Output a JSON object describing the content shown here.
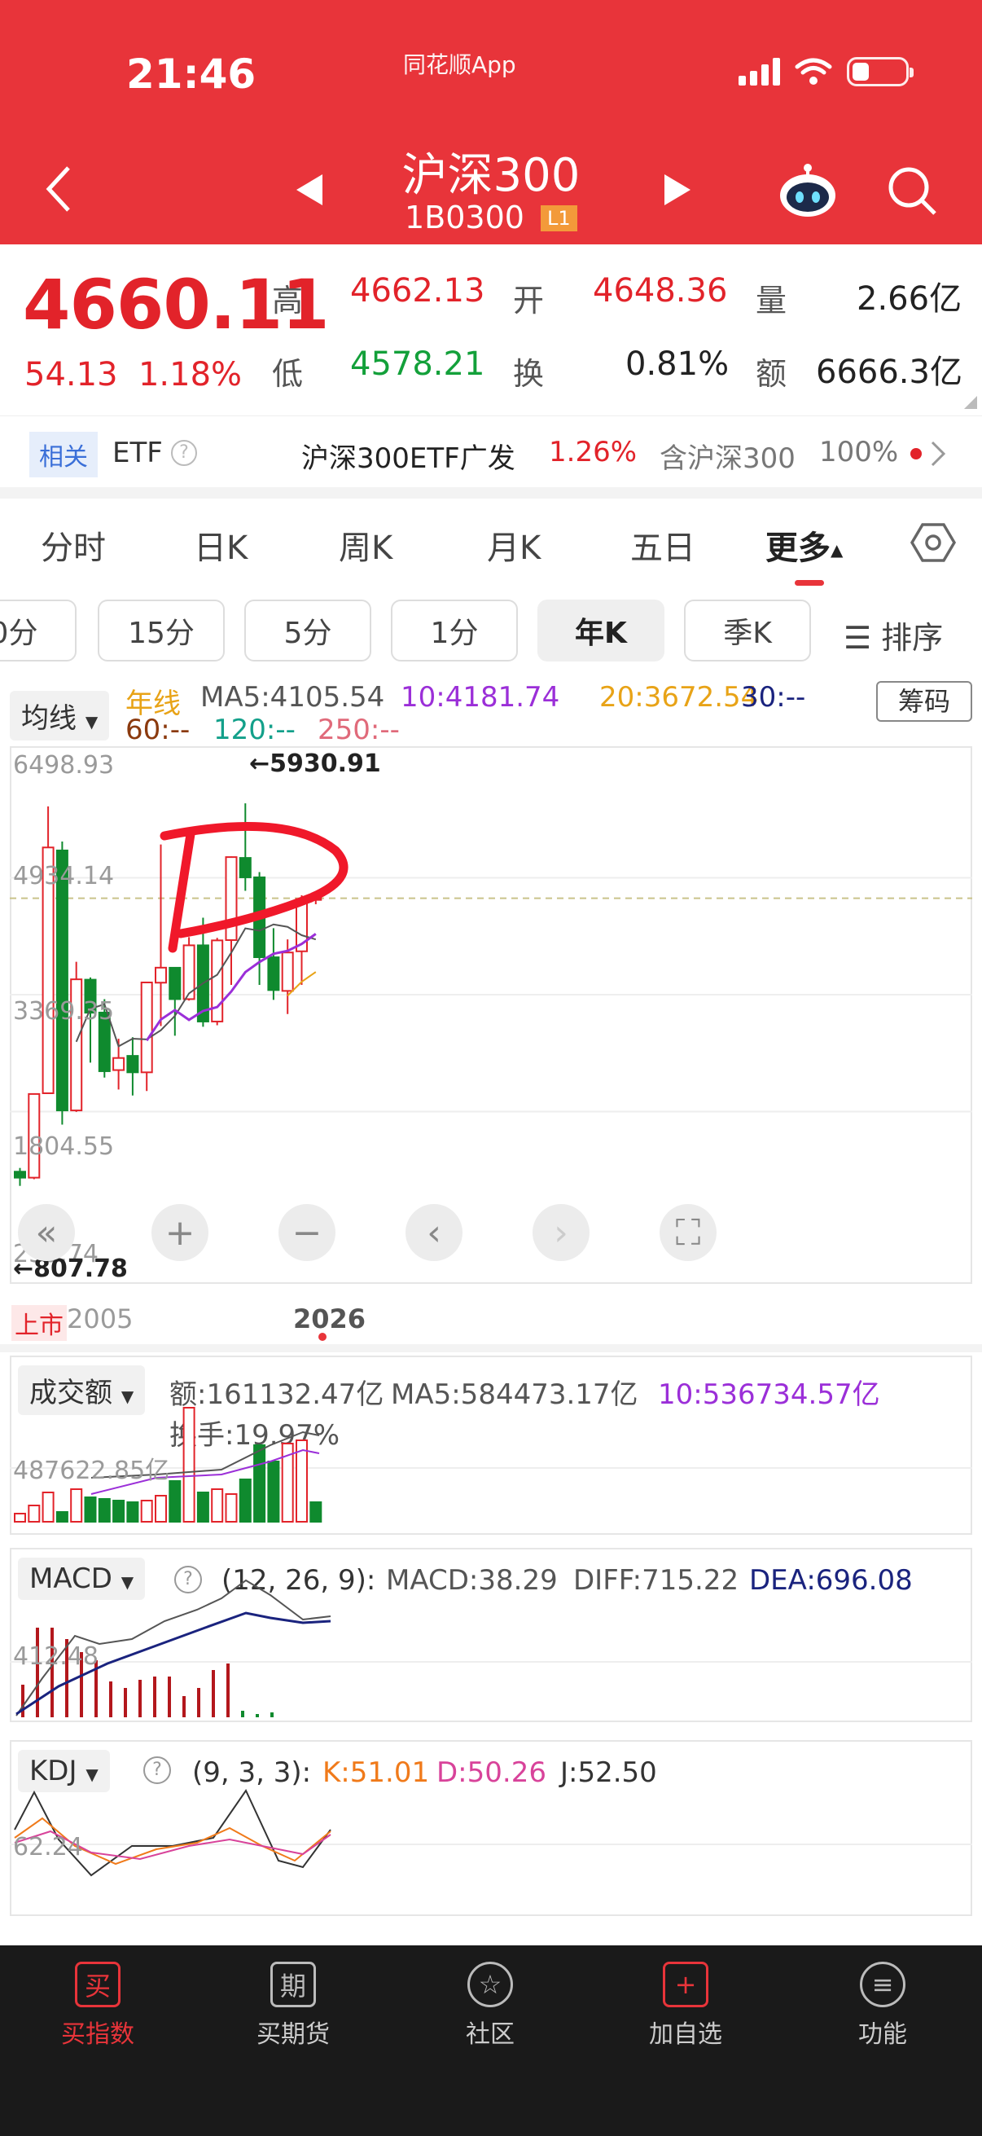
{
  "status_bar": {
    "time": "21:46",
    "app_name": "同花顺App"
  },
  "header": {
    "title": "沪深300",
    "code": "1B0300",
    "level_badge": "L1"
  },
  "quote": {
    "price": "4660.11",
    "change": "54.13",
    "change_pct": "1.18%",
    "high_label": "高",
    "high": "4662.13",
    "open_label": "开",
    "open": "4648.36",
    "volume_label": "量",
    "volume": "2.66亿",
    "low_label": "低",
    "low": "4578.21",
    "turnover_label": "换",
    "turnover": "0.81%",
    "amount_label": "额",
    "amount": "6666.3亿"
  },
  "etf": {
    "tag": "相关",
    "label": "ETF",
    "name": "沪深300ETF广发",
    "pct": "1.26%",
    "contains": "含沪深300",
    "contains_pct": "100%"
  },
  "tabs": [
    "分时",
    "日K",
    "周K",
    "月K",
    "五日",
    "更多"
  ],
  "periods": [
    "0分",
    "15分",
    "5分",
    "1分",
    "年K",
    "季K",
    "排序"
  ],
  "main_chart": {
    "indicator_dropdown": "均线",
    "ma_label": "年线",
    "ma5": "MA5:4105.54",
    "ma10": "10:4181.74",
    "ma20": "20:3672.54",
    "ma30": "30:--",
    "ma60": "60:--",
    "ma120": "120:--",
    "ma250": "250:--",
    "chip_button": "筹码",
    "y_labels": [
      "6498.93",
      "4934.14",
      "3369.35",
      "1804.55",
      "239.74"
    ],
    "high_mark": "←5930.91",
    "low_mark": "←807.78",
    "x_start_label": "上市",
    "x_start": "2005",
    "x_end": "2026"
  },
  "volume_panel": {
    "dropdown": "成交额",
    "amount": "额:161132.47亿",
    "ma5": "MA5:584473.17亿",
    "ma10": "10:536734.57亿",
    "turnover": "换手:19.97%",
    "y_label": "487622.85亿"
  },
  "macd_panel": {
    "dropdown": "MACD",
    "params": "(12, 26, 9):",
    "macd": "MACD:38.29",
    "diff": "DIFF:715.22",
    "dea": "DEA:696.08",
    "y_label": "412.48"
  },
  "kdj_panel": {
    "dropdown": "KDJ",
    "params": "(9, 3, 3):",
    "k": "K:51.01",
    "d": "D:50.26",
    "j": "J:52.50",
    "y_label": "62.24"
  },
  "bottom_nav": [
    "买指数",
    "买期货",
    "社区",
    "加自选",
    "功能"
  ],
  "colors": {
    "brand_red": "#e8343a",
    "up": "#e2232a",
    "down": "#13a03a"
  },
  "chart_data": {
    "type": "candlestick",
    "period": "year",
    "x": [
      "2005",
      "2006",
      "2007",
      "2008",
      "2009",
      "2010",
      "2011",
      "2012",
      "2013",
      "2014",
      "2015",
      "2016",
      "2017",
      "2018",
      "2019",
      "2020",
      "2021",
      "2022",
      "2023",
      "2024",
      "2025",
      "2026"
    ],
    "open": [
      1000,
      920,
      2050,
      5300,
      1820,
      3570,
      3130,
      2360,
      2550,
      2330,
      3530,
      3730,
      3310,
      4030,
      3010,
      4100,
      5200,
      4940,
      3870,
      3420,
      3950,
      4650
    ],
    "close": [
      920,
      2040,
      5340,
      1820,
      3575,
      3128,
      2345,
      2522,
      2330,
      3533,
      3731,
      3310,
      4030,
      3010,
      4096,
      5211,
      4940,
      3871,
      3431,
      3934,
      4650,
      4660
    ],
    "high": [
      1050,
      2050,
      5890,
      5420,
      3810,
      3600,
      3310,
      2780,
      2800,
      3530,
      5380,
      3730,
      4140,
      4400,
      4130,
      5220,
      5930,
      5010,
      4260,
      4110,
      4700,
      4680
    ],
    "low": [
      810,
      900,
      2050,
      1630,
      1800,
      2460,
      2260,
      2100,
      2020,
      2080,
      2950,
      2820,
      3290,
      2940,
      2960,
      3500,
      4760,
      3500,
      3300,
      3110,
      3500,
      4580
    ],
    "ylim": [
      239.74,
      6498.93
    ]
  }
}
